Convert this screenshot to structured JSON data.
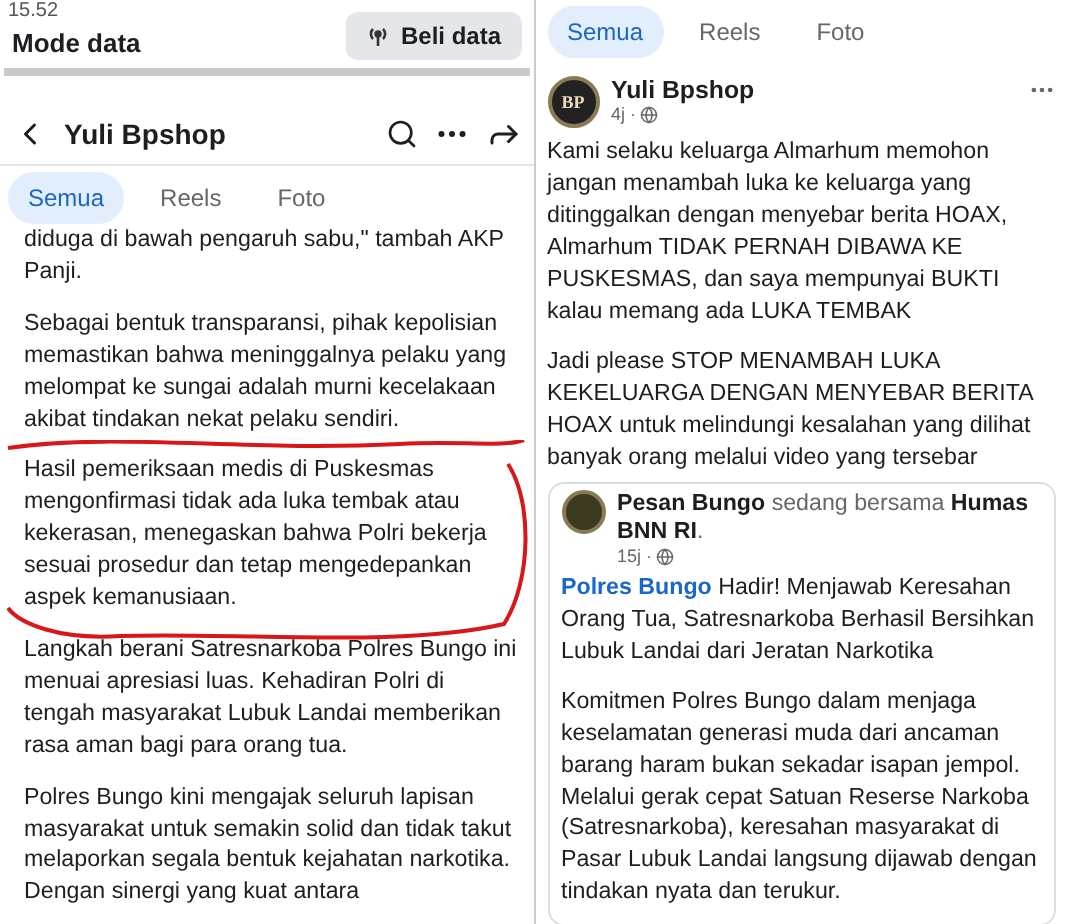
{
  "left_screen": {
    "status_bar": {
      "time": "15.52",
      "mode": "Mode data",
      "button": "Beli data"
    },
    "header": {
      "title": "Yuli Bpshop"
    },
    "tabs": [
      {
        "label": "Semua",
        "selected": true
      },
      {
        "label": "Reels",
        "selected": false
      },
      {
        "label": "Foto",
        "selected": false
      }
    ],
    "paragraphs": [
      {
        "text": "diduga di bawah pengaruh sabu,\" tambah AKP Panji.",
        "circled": false
      },
      {
        "text": "Sebagai bentuk transparansi, pihak kepolisian memastikan bahwa meninggalnya pelaku yang melompat ke sungai adalah murni kecelakaan akibat tindakan nekat pelaku sendiri.",
        "circled": false
      },
      {
        "text": "Hasil pemeriksaan medis di Puskesmas mengonfirmasi tidak ada luka tembak atau kekerasan, menegaskan bahwa Polri bekerja sesuai prosedur dan tetap mengedepankan aspek kemanusiaan.",
        "circled": true
      },
      {
        "text": "Langkah berani Satresnarkoba Polres Bungo ini menuai apresiasi luas. Kehadiran Polri di tengah masyarakat Lubuk Landai memberikan rasa aman bagi para orang tua.",
        "circled": false
      },
      {
        "text": "Polres Bungo kini mengajak seluruh lapisan masyarakat untuk semakin solid dan tidak takut melaporkan segala bentuk kejahatan narkotika. Dengan sinergi yang kuat antara",
        "circled": false
      }
    ]
  },
  "right_screen": {
    "tabs": [
      {
        "label": "Semua",
        "selected": true
      },
      {
        "label": "Reels",
        "selected": false
      },
      {
        "label": "Foto",
        "selected": false
      }
    ],
    "post": {
      "avatar": "BP",
      "author": "Yuli Bpshop",
      "time": "4j ·",
      "paragraphs": [
        "Kami selaku keluarga Almarhum memohon jangan menambah luka ke keluarga yang ditinggalkan dengan menyebar berita HOAX, Almarhum TIDAK PERNAH DIBAWA KE PUSKESMAS, dan saya mempunyai BUKTI kalau memang ada LUKA TEMBAK",
        "Jadi please STOP MENAMBAH LUKA KEKELUARGA DENGAN MENYEBAR BERITA HOAX untuk melindungi kesalahan yang dilihat banyak orang melalui video yang tersebar"
      ],
      "shared": {
        "author_line": "**Pesan Bungo** sedang bersama **Humas BNN RI**.",
        "time": "15j ·",
        "link": "Polres Bungo",
        "lead": "Hadir! Menjawab Keresahan Orang Tua, Satresnarkoba Berhasil Bersihkan Lubuk Landai dari Jeratan Narkotika",
        "paragraphs": [
          "Komitmen Polres Bungo dalam menjaga keselamatan generasi muda dari ancaman barang haram bukan sekadar isapan jempol. Melalui gerak cepat Satuan Reserse Narkoba (Satresnarkoba), keresahan masyarakat di Pasar Lubuk Landai langsung dijawab dengan tindakan nyata dan terukur."
        ]
      }
    }
  }
}
